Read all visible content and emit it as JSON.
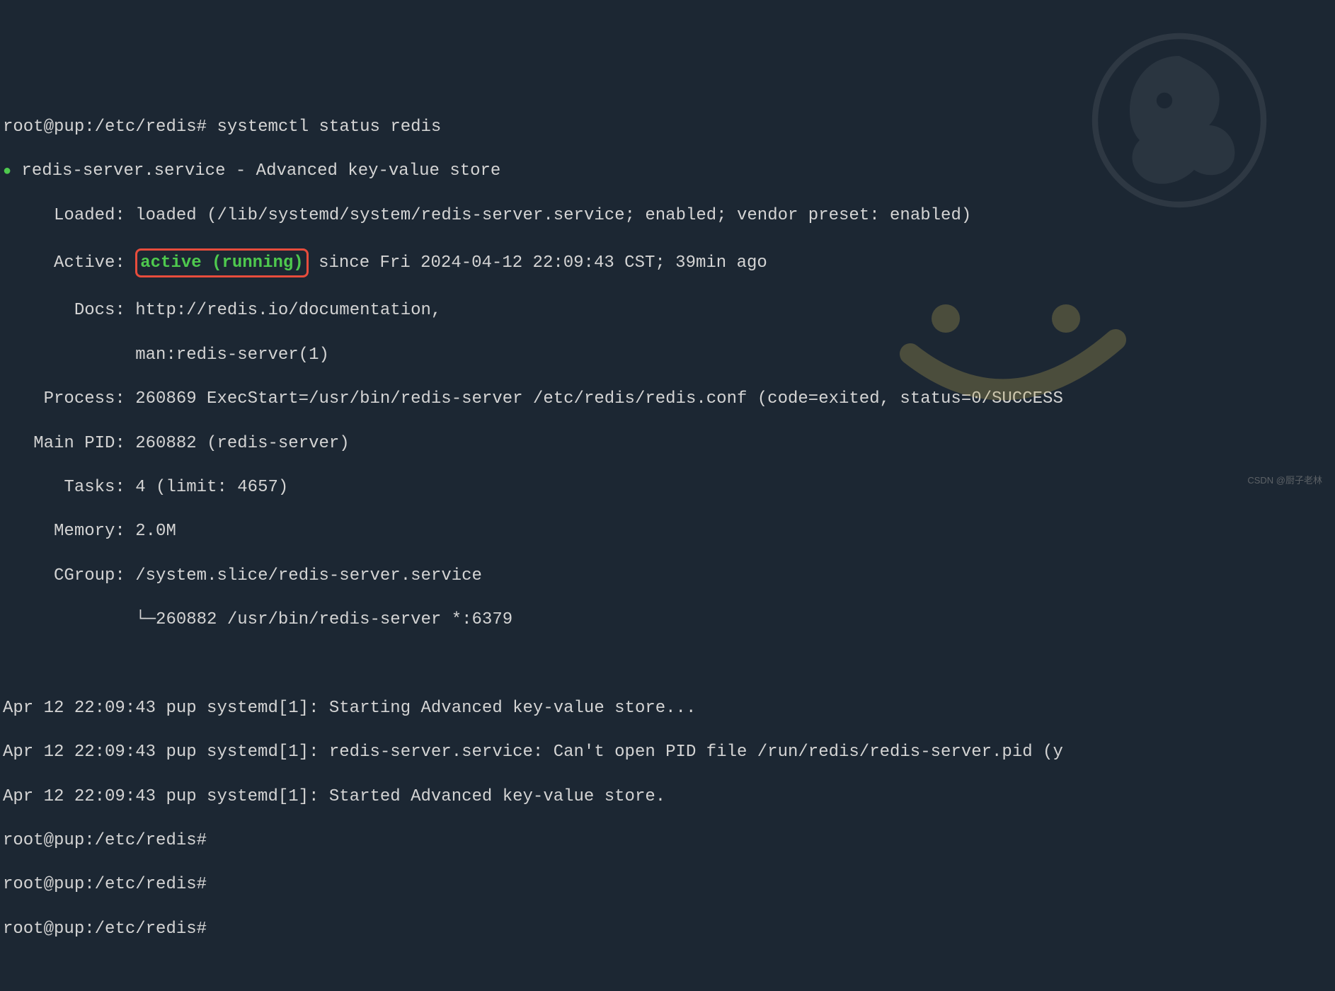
{
  "prompt": {
    "user": "root",
    "host": "pup",
    "path": "/etc/redis",
    "symbol": "#"
  },
  "command": "systemctl status redis",
  "status": {
    "service_header": "redis-server.service - Advanced key-value store",
    "loaded_label": "Loaded:",
    "loaded_value": "loaded (/lib/systemd/system/redis-server.service; enabled; vendor preset: enabled)",
    "active_label": "Active:",
    "active_status": "active (running)",
    "active_since": "since Fri 2024-04-12 22:09:43 CST; 39min ago",
    "docs_label": "Docs:",
    "docs_line1": "http://redis.io/documentation,",
    "docs_line2": "man:redis-server(1)",
    "process_label": "Process:",
    "process_value": "260869 ExecStart=/usr/bin/redis-server /etc/redis/redis.conf (code=exited, status=0/SUCCESS",
    "main_pid_label": "Main PID:",
    "main_pid_value": "260882 (redis-server)",
    "tasks_label": "Tasks:",
    "tasks_value": "4 (limit: 4657)",
    "memory_label": "Memory:",
    "memory_value": "2.0M",
    "cgroup_label": "CGroup:",
    "cgroup_value": "/system.slice/redis-server.service",
    "cgroup_tree": "└─260882 /usr/bin/redis-server *:6379"
  },
  "logs": {
    "line1": "Apr 12 22:09:43 pup systemd[1]: Starting Advanced key-value store...",
    "line2": "Apr 12 22:09:43 pup systemd[1]: redis-server.service: Can't open PID file /run/redis/redis-server.pid (y",
    "line3": "Apr 12 22:09:43 pup systemd[1]: Started Advanced key-value store."
  },
  "watermark": "CSDN @厨子老林"
}
